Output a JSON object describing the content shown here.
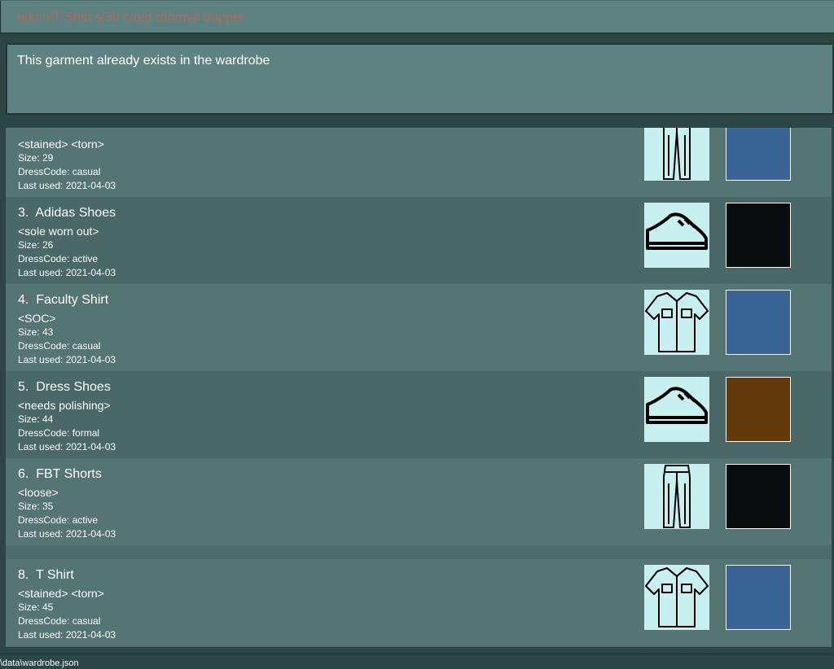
{
  "command": {
    "value": "add n/T Shirt s/30 c/red r/formal t/upper"
  },
  "result": {
    "message": "This garment already exists in the wardrobe"
  },
  "garments": [
    {
      "title": "",
      "tags": "<stained> <torn>",
      "size": "Size: 29",
      "dresscode": "DressCode: casual",
      "last_used": "Last used: 2021-04-03",
      "type_icon": "pants-icon",
      "color": "#3a6496"
    },
    {
      "title": "3.  Adidas Shoes",
      "tags": "<sole worn out>",
      "size": "Size: 26",
      "dresscode": "DressCode: active",
      "last_used": "Last used: 2021-04-03",
      "type_icon": "shoe-icon",
      "color": "#080c0c"
    },
    {
      "title": "4.  Faculty Shirt",
      "tags": "<SOC>",
      "size": "Size: 43",
      "dresscode": "DressCode: casual",
      "last_used": "Last used: 2021-04-03",
      "type_icon": "shirt-icon",
      "color": "#3a6496"
    },
    {
      "title": "5.  Dress Shoes",
      "tags": "<needs polishing>",
      "size": "Size: 44",
      "dresscode": "DressCode: formal",
      "last_used": "Last used: 2021-04-03",
      "type_icon": "shoe-icon",
      "color": "#623a0c"
    },
    {
      "title": "6.  FBT Shorts",
      "tags": "<loose>",
      "size": "Size: 35",
      "dresscode": "DressCode: active",
      "last_used": "Last used: 2021-04-03",
      "type_icon": "pants-icon",
      "color": "#080c0c"
    },
    {
      "title": "8.  T Shirt",
      "tags": "<stained> <torn>",
      "size": "Size: 45",
      "dresscode": "DressCode: casual",
      "last_used": "Last used: 2021-04-03",
      "type_icon": "shirt-icon",
      "color": "#3a6496"
    }
  ],
  "status_bar": {
    "text": "\\data\\wardrobe.json"
  }
}
